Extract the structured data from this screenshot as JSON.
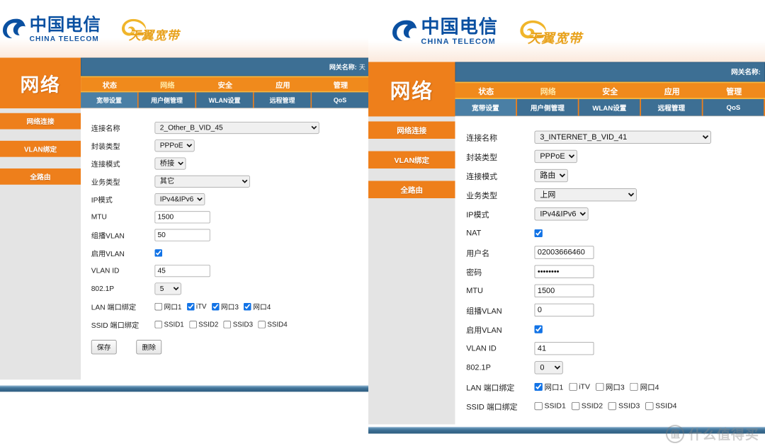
{
  "brand": {
    "telecom_cn": "中国电信",
    "telecom_en": "CHINA TELECOM",
    "tianyi": "天翼宽带"
  },
  "header": {
    "section_title": "网络",
    "gateway_label": "网关名称:",
    "gateway_value": "天"
  },
  "main_tabs": [
    {
      "label": "状态",
      "active": false
    },
    {
      "label": "网络",
      "active": true
    },
    {
      "label": "安全",
      "active": false
    },
    {
      "label": "应用",
      "active": false
    },
    {
      "label": "管理",
      "active": false
    }
  ],
  "sub_tabs": [
    {
      "label": "宽带设置",
      "active": true
    },
    {
      "label": "用户侧管理",
      "active": false
    },
    {
      "label": "WLAN设置",
      "active": false
    },
    {
      "label": "远程管理",
      "active": false
    },
    {
      "label": "QoS",
      "active": false
    }
  ],
  "sidenav": [
    {
      "label": "网络连接"
    },
    {
      "label": "VLAN绑定"
    },
    {
      "label": "全路由"
    }
  ],
  "labels": {
    "conn_name": "连接名称",
    "encap_type": "封装类型",
    "conn_mode": "连接模式",
    "service_type": "业务类型",
    "ip_mode": "IP模式",
    "nat": "NAT",
    "username": "用户名",
    "password": "密码",
    "mtu": "MTU",
    "multicast_vlan": "组播VLAN",
    "enable_vlan": "启用VLAN",
    "vlan_id": "VLAN ID",
    "dot1p": "802.1P",
    "lan_bind": "LAN 端口绑定",
    "ssid_bind": "SSID 端口绑定"
  },
  "left_panel": {
    "conn_name": "2_Other_B_VID_45",
    "encap_type": "PPPoE",
    "conn_mode": "桥接",
    "service_type": "其它",
    "ip_mode": "IPv4&IPv6",
    "mtu": "1500",
    "multicast_vlan": "50",
    "enable_vlan": true,
    "vlan_id": "45",
    "dot1p": "5",
    "lan_ports": [
      {
        "label": "网口1",
        "checked": false
      },
      {
        "label": "iTV",
        "checked": true
      },
      {
        "label": "网口3",
        "checked": true
      },
      {
        "label": "网口4",
        "checked": true
      }
    ],
    "ssid_ports": [
      {
        "label": "SSID1",
        "checked": false
      },
      {
        "label": "SSID2",
        "checked": false
      },
      {
        "label": "SSID3",
        "checked": false
      },
      {
        "label": "SSID4",
        "checked": false
      }
    ],
    "save_label": "保存",
    "delete_label": "删除"
  },
  "right_panel": {
    "conn_name": "3_INTERNET_B_VID_41",
    "encap_type": "PPPoE",
    "conn_mode": "路由",
    "service_type": "上网",
    "ip_mode": "IPv4&IPv6",
    "nat": true,
    "username": "02003666460",
    "password": "••••••••",
    "mtu": "1500",
    "multicast_vlan": "0",
    "enable_vlan": true,
    "vlan_id": "41",
    "dot1p": "0",
    "lan_ports": [
      {
        "label": "网口1",
        "checked": true
      },
      {
        "label": "iTV",
        "checked": false
      },
      {
        "label": "网口3",
        "checked": false
      },
      {
        "label": "网口4",
        "checked": false
      }
    ],
    "ssid_ports": [
      {
        "label": "SSID1",
        "checked": false
      },
      {
        "label": "SSID2",
        "checked": false
      },
      {
        "label": "SSID3",
        "checked": false
      },
      {
        "label": "SSID4",
        "checked": false
      }
    ]
  },
  "watermark": {
    "mark": "值",
    "text": "什么值得买"
  },
  "colors": {
    "orange": "#ee7f1b",
    "orange_light": "#f08a1c",
    "blue": "#3d6f94",
    "gold": "#f5b942",
    "telecom_blue": "#0a50a1",
    "tianyi_gold": "#e8a11a"
  }
}
